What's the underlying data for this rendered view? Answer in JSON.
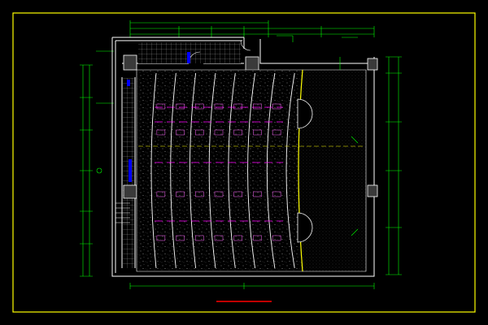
{
  "drawing": {
    "title": "",
    "scale_note": "",
    "background": "#000000",
    "frame_color": "#ffff00",
    "wall_color": "#ffffff",
    "dimension_color": "#00ff00",
    "seat_row_color": "#ff00ff",
    "axis_color": "#ffff00",
    "title_underline_color": "#ff0000",
    "door_color": "#0000ff",
    "row_count": 8,
    "aisle_count": 3
  }
}
